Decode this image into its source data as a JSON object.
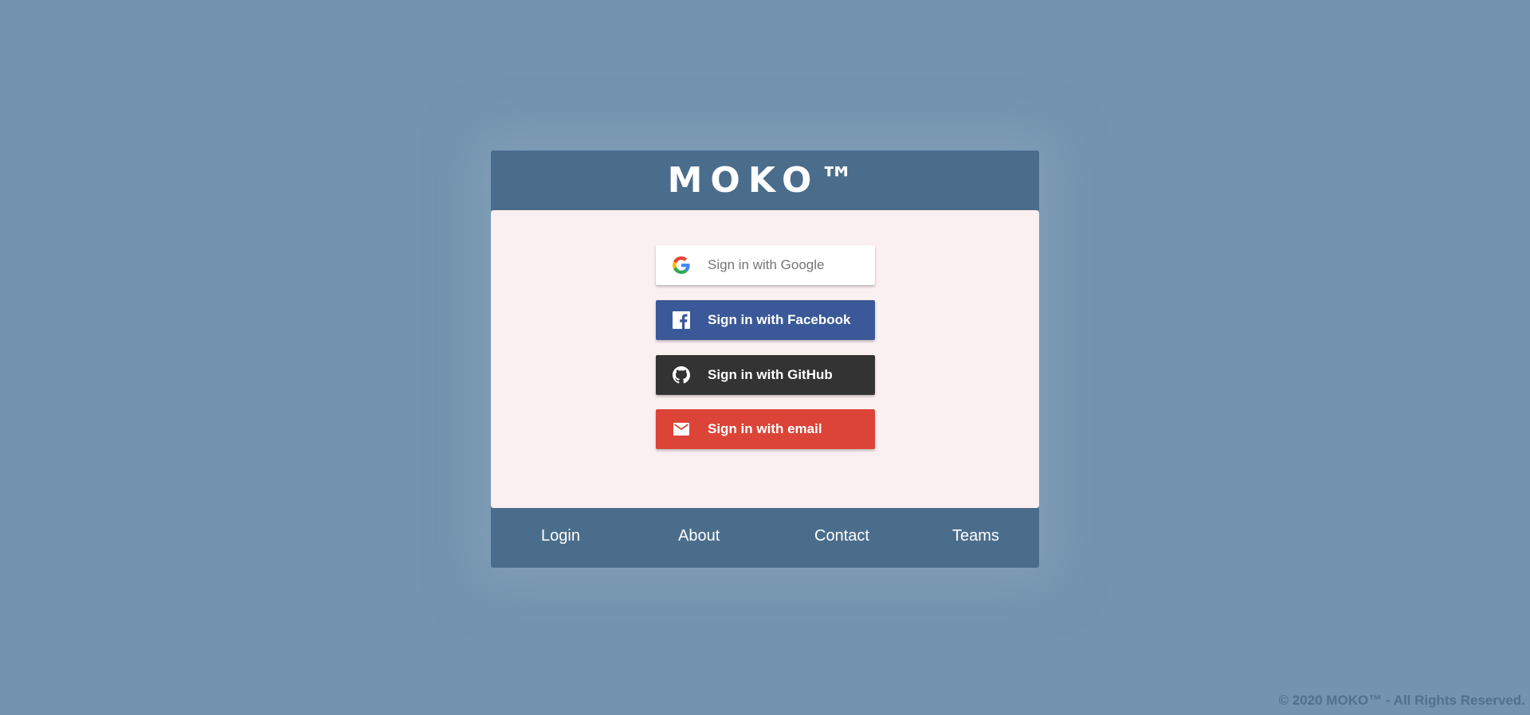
{
  "header": {
    "logo_text": "MOKO™"
  },
  "signin": {
    "google_label": "Sign in with Google",
    "facebook_label": "Sign in with Facebook",
    "github_label": "Sign in with GitHub",
    "email_label": "Sign in with email",
    "icons": [
      "google-icon",
      "facebook-icon",
      "github-icon",
      "email-icon"
    ]
  },
  "footer_nav": {
    "login": "Login",
    "about": "About",
    "contact": "Contact",
    "teams": "Teams"
  },
  "copyright": "© 2020 MOKO™ - All Rights Reserved.",
  "colors": {
    "background": "#7393ae",
    "header": "#4b6d8c",
    "card_body": "#fbf0f1",
    "google": "#ffffff",
    "facebook": "#3b5998",
    "github": "#333333",
    "email": "#db4437"
  }
}
